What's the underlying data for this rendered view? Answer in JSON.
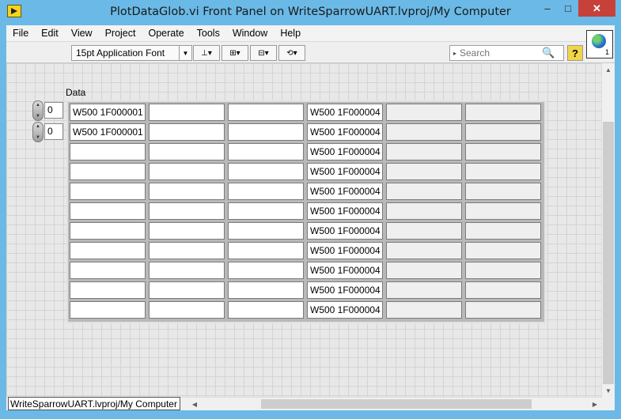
{
  "window": {
    "title": "PlotDataGlob.vi Front Panel on WriteSparrowUART.lvproj/My Computer",
    "minimize_glyph": "–",
    "maximize_glyph": "□",
    "close_glyph": "✕"
  },
  "menu": [
    "File",
    "Edit",
    "View",
    "Project",
    "Operate",
    "Tools",
    "Window",
    "Help"
  ],
  "toolbar": {
    "font_label": "15pt Application Font",
    "search_placeholder": "Search",
    "help_label": "?",
    "icons": [
      "align-objects-icon",
      "distribute-objects-icon",
      "resize-objects-icon",
      "reorder-icon"
    ]
  },
  "vi_icon": {
    "number": "1"
  },
  "panel": {
    "array_label": "Data",
    "indices": [
      "0",
      "0"
    ],
    "rows": [
      [
        "W500 1F000001",
        "",
        "",
        "W500 1F000004",
        "",
        ""
      ],
      [
        "W500 1F000001",
        "",
        "",
        "W500 1F000004",
        "",
        ""
      ],
      [
        "",
        "",
        "",
        "W500 1F000004",
        "",
        ""
      ],
      [
        "",
        "",
        "",
        "W500 1F000004",
        "",
        ""
      ],
      [
        "",
        "",
        "",
        "W500 1F000004",
        "",
        ""
      ],
      [
        "",
        "",
        "",
        "W500 1F000004",
        "",
        ""
      ],
      [
        "",
        "",
        "",
        "W500 1F000004",
        "",
        ""
      ],
      [
        "",
        "",
        "",
        "W500 1F000004",
        "",
        ""
      ],
      [
        "",
        "",
        "",
        "W500 1F000004",
        "",
        ""
      ],
      [
        "",
        "",
        "",
        "W500 1F000004",
        "",
        ""
      ],
      [
        "",
        "",
        "",
        "W500 1F000004",
        "",
        ""
      ]
    ]
  },
  "status": {
    "context": "WriteSparrowUART.lvproj/My Computer"
  }
}
